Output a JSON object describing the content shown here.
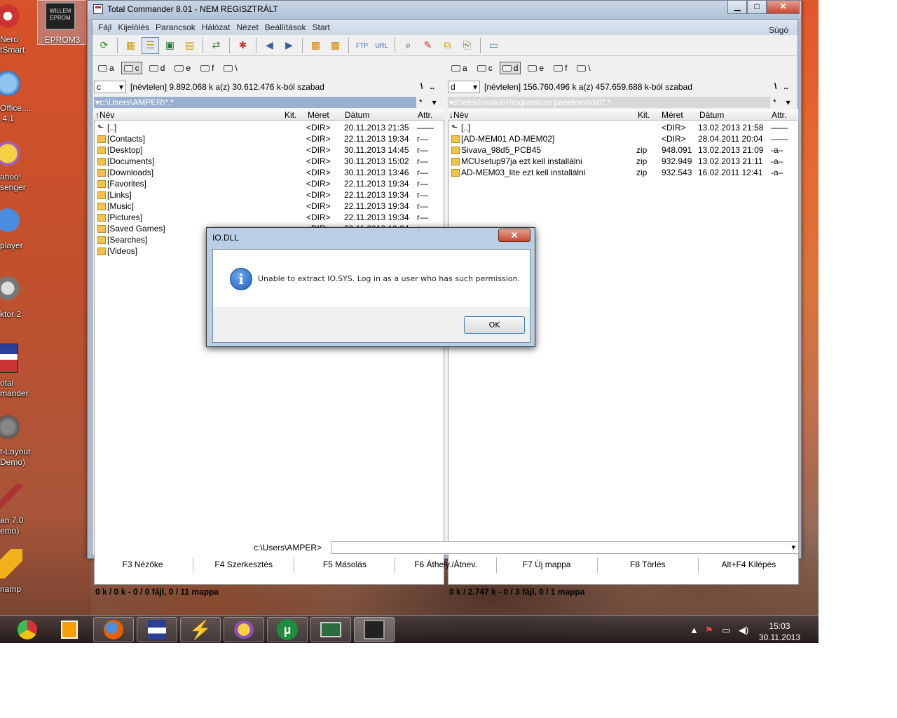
{
  "desktop": {
    "icons": [
      {
        "label1": "Nero",
        "label2": "tSmart",
        "icon": "nero-icon"
      },
      {
        "label1": "Office....",
        "label2": ".4.1",
        "icon": "openoffice-icon"
      },
      {
        "label1": "ahoo!",
        "label2": "senger",
        "icon": "yahoo-messenger-icon"
      },
      {
        "label1": "player",
        "label2": "",
        "icon": "bsplayer-icon"
      },
      {
        "label1": "ktor 2",
        "label2": "",
        "icon": "doktor-icon"
      },
      {
        "label1": "otal",
        "label2": "mander",
        "icon": "total-commander-icon"
      },
      {
        "label1": "t-Layout",
        "label2": "Demo)",
        "icon": "layout-icon"
      },
      {
        "label1": "an 7.0",
        "label2": "emo)",
        "icon": "sprint-icon"
      },
      {
        "label1": "namp",
        "label2": "",
        "icon": "winamp-icon"
      }
    ],
    "eprom": {
      "label": "EPROM3",
      "chip_line1": "WILLEM",
      "chip_line2": "EPROM"
    }
  },
  "tc": {
    "title": "Total Commander 8.01 - NEM REGISZTRÁLT",
    "menu": [
      "Fájl",
      "Kijelölés",
      "Parancsok",
      "Hálózat",
      "Nézet",
      "Beállítások",
      "Start"
    ],
    "help": "Súgó",
    "drives": [
      "a",
      "c",
      "d",
      "e",
      "f",
      "\\"
    ],
    "left": {
      "drive": "c",
      "info": "[névtelen]  9.892.068 k a(z) 30.612.476 k-ból szabad",
      "path": "c:\\Users\\AMPER\\*.*",
      "headers": {
        "name": "↑Név",
        "ext": "Kit.",
        "size": "Méret",
        "date": "Dátum",
        "attr": "Attr."
      },
      "rows": [
        {
          "name": "[..]",
          "ext": "",
          "size": "<DIR>",
          "date": "20.11.2013 21:35",
          "attr": "——",
          "up": true
        },
        {
          "name": "[Contacts]",
          "ext": "",
          "size": "<DIR>",
          "date": "22.11.2013 19:34",
          "attr": "r—"
        },
        {
          "name": "[Desktop]",
          "ext": "",
          "size": "<DIR>",
          "date": "30.11.2013 14:45",
          "attr": "r—"
        },
        {
          "name": "[Documents]",
          "ext": "",
          "size": "<DIR>",
          "date": "30.11.2013 15:02",
          "attr": "r—"
        },
        {
          "name": "[Downloads]",
          "ext": "",
          "size": "<DIR>",
          "date": "30.11.2013 13:46",
          "attr": "r—"
        },
        {
          "name": "[Favorites]",
          "ext": "",
          "size": "<DIR>",
          "date": "22.11.2013 19:34",
          "attr": "r—"
        },
        {
          "name": "[Links]",
          "ext": "",
          "size": "<DIR>",
          "date": "22.11.2013 19:34",
          "attr": "r—"
        },
        {
          "name": "[Music]",
          "ext": "",
          "size": "<DIR>",
          "date": "22.11.2013 19:34",
          "attr": "r—"
        },
        {
          "name": "[Pictures]",
          "ext": "",
          "size": "<DIR>",
          "date": "22.11.2013 19:34",
          "attr": "r—"
        },
        {
          "name": "[Saved Games]",
          "ext": "",
          "size": "<DIR>",
          "date": "22.11.2013 19:34",
          "attr": "r—"
        },
        {
          "name": "[Searches]",
          "ext": "",
          "size": "",
          "date": "",
          "attr": ""
        },
        {
          "name": "[Videos]",
          "ext": "",
          "size": "",
          "date": "",
          "attr": ""
        }
      ],
      "status": "0 k / 0 k - 0 / 0 fájl, 0 / 11 mappa"
    },
    "right": {
      "drive": "d",
      "info": "[névtelen]  156.760.496 k a(z) 457.659.688 k-ból szabad",
      "path": "d:\\elektronika\\Programozo panelomhoz\\*.*",
      "headers": {
        "name": "↓Név",
        "ext": "Kit.",
        "size": "Méret",
        "date": "Dátum",
        "attr": "Attr."
      },
      "rows": [
        {
          "name": "[..]",
          "ext": "",
          "size": "<DIR>",
          "date": "13.02.2013 21:58",
          "attr": "——",
          "up": true
        },
        {
          "name": "[AD-MEM01 AD-MEM02]",
          "ext": "",
          "size": "<DIR>",
          "date": "28.04.2011 20:04",
          "attr": "——"
        },
        {
          "name": "Sivava_98d5_PCB45",
          "ext": "zip",
          "size": "948.091",
          "date": "13.02.2013 21:09",
          "attr": "-a–"
        },
        {
          "name": "MCUsetup97ja ezt kell installálni",
          "ext": "zip",
          "size": "932.949",
          "date": "13.02.2013 21:11",
          "attr": "-a–"
        },
        {
          "name": "AD-MEM03_lite ezt kell installálni",
          "ext": "zip",
          "size": "932.543",
          "date": "16.02.2011 12:41",
          "attr": "-a–"
        }
      ],
      "status": "0 k / 2.747 k - 0 / 3 fájl, 0 / 1 mappa"
    },
    "cmd_label": "c:\\Users\\AMPER>",
    "fkeys": [
      "F3 Nézőke",
      "F4 Szerkesztés",
      "F5 Másolás",
      "F6 Áthely./Átnev.",
      "F7 Új mappa",
      "F8 Törlés",
      "Alt+F4 Kilépés"
    ]
  },
  "dialog": {
    "title": "IO.DLL",
    "close": "✕",
    "message": "Unable to extract IO.SYS. Log in as a user who has such permission.",
    "ok": "OK"
  },
  "tray": {
    "time": "15:03",
    "date": "30.11.2013"
  }
}
